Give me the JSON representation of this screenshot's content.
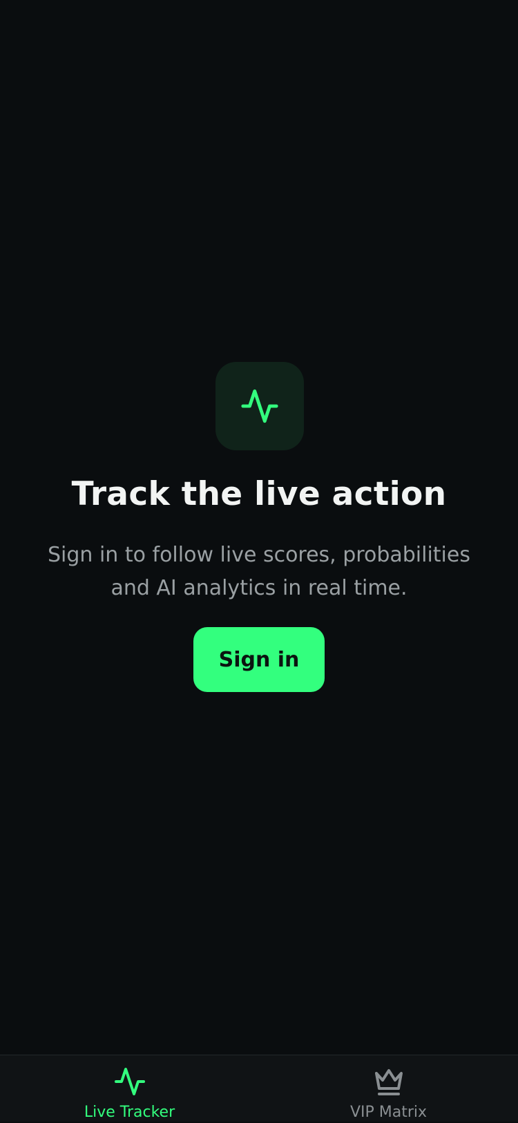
{
  "hero": {
    "icon": "activity-pulse-icon",
    "title": "Track the live action",
    "subtitle": "Sign in to follow live scores, probabilities and AI analytics in real time.",
    "signin_label": "Sign in"
  },
  "tabs": [
    {
      "label": "Live Tracker",
      "icon": "activity-pulse-icon",
      "active": true
    },
    {
      "label": "VIP Matrix",
      "icon": "crown-icon",
      "active": false
    }
  ],
  "colors": {
    "background": "#0a0d0f",
    "accent": "#33ff7e",
    "icon_tile": "#10231a",
    "tabbar": "#101315",
    "inactive": "#8a8f92"
  }
}
